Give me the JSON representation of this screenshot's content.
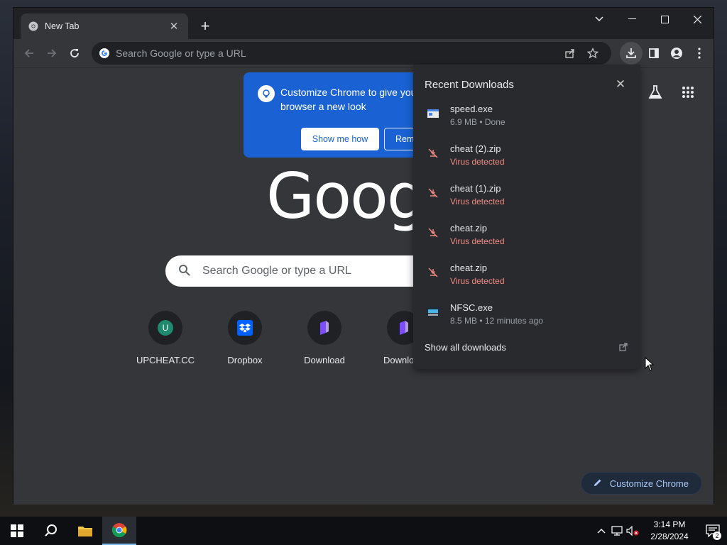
{
  "window": {
    "tab_title": "New Tab",
    "tab_close_label": "✕",
    "new_tab_label": "+"
  },
  "toolbar": {
    "omnibox_placeholder": "Search Google or type a URL"
  },
  "promo": {
    "text": "Customize Chrome to give your browser a new look",
    "primary_button": "Show me how",
    "secondary_button": "Remind me later"
  },
  "ntp": {
    "logo_text": "Google",
    "search_placeholder": "Search Google or type a URL",
    "shortcuts": [
      {
        "label": "UPCHEAT.CC",
        "icon": "u-letter-icon",
        "badge": "U"
      },
      {
        "label": "Dropbox",
        "icon": "dropbox-icon"
      },
      {
        "label": "Download",
        "icon": "purple-app-icon"
      },
      {
        "label": "Download",
        "icon": "purple-app-icon"
      }
    ],
    "customize_button": "Customize Chrome"
  },
  "downloads": {
    "title": "Recent Downloads",
    "items": [
      {
        "name": "speed.exe",
        "status": "6.9 MB • Done",
        "danger": false,
        "icon": "exe-file-icon"
      },
      {
        "name": "cheat (2).zip",
        "status": "Virus detected",
        "danger": true,
        "icon": "blocked-download-icon"
      },
      {
        "name": "cheat (1).zip",
        "status": "Virus detected",
        "danger": true,
        "icon": "blocked-download-icon"
      },
      {
        "name": "cheat.zip",
        "status": "Virus detected",
        "danger": true,
        "icon": "blocked-download-icon"
      },
      {
        "name": "cheat.zip",
        "status": "Virus detected",
        "danger": true,
        "icon": "blocked-download-icon"
      },
      {
        "name": "NFSC.exe",
        "status": "8.5 MB • 12 minutes ago",
        "danger": false,
        "icon": "nfs-app-icon"
      }
    ],
    "show_all": "Show all downloads"
  },
  "taskbar": {
    "time": "3:14 PM",
    "date": "2/28/2024",
    "notification_count": "2"
  },
  "colors": {
    "accent_blue": "#1a62d3",
    "danger_red": "#f28b82",
    "surface": "#35363a"
  }
}
